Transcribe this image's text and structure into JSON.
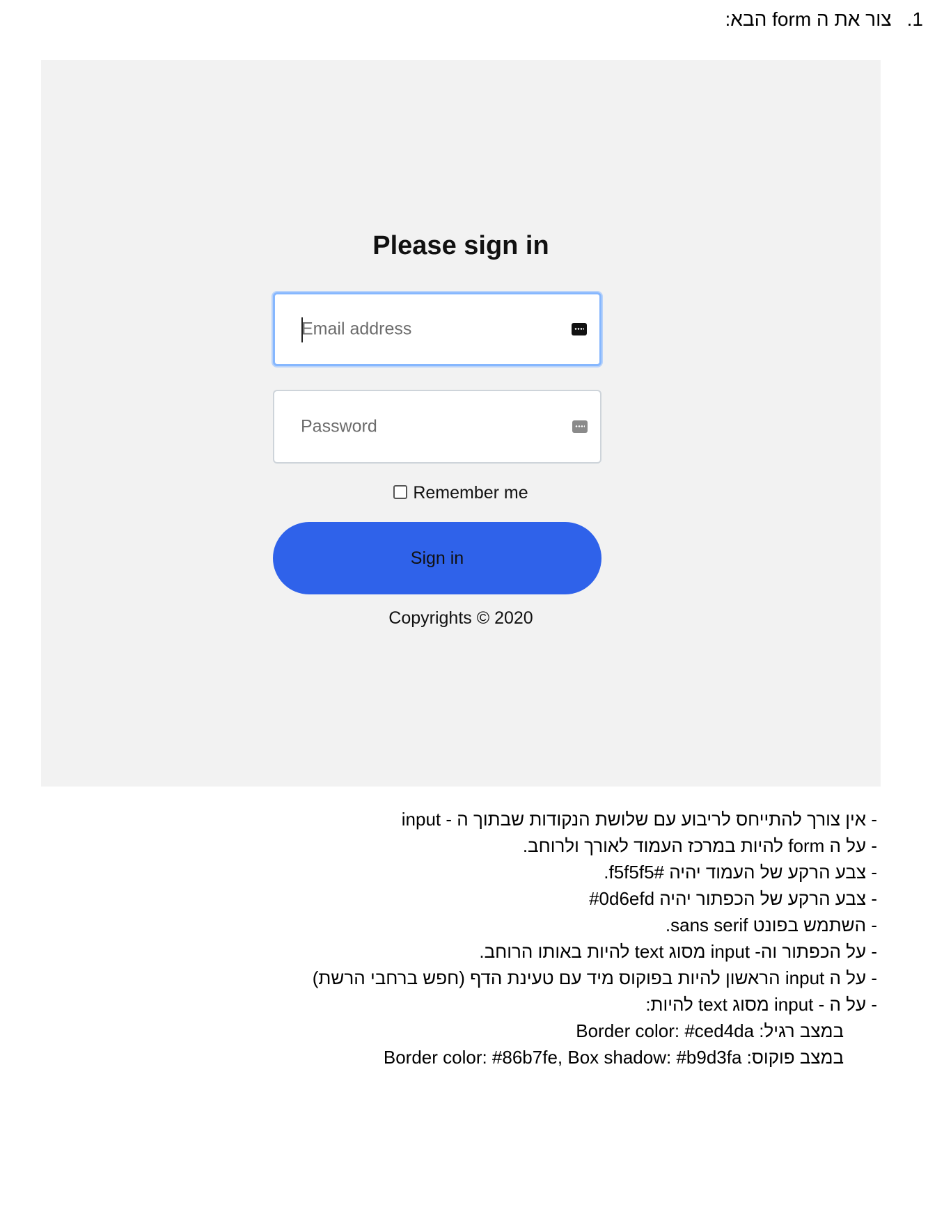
{
  "heading": {
    "number": "1.",
    "text": "צור את ה form הבא:"
  },
  "form": {
    "title": "Please sign in",
    "email_placeholder": "Email address",
    "password_placeholder": "Password",
    "remember_label": "Remember me",
    "signin_label": "Sign in",
    "copyright": "Copyrights © 2020",
    "colors": {
      "page_bg": "#f2f2f2",
      "button_bg": "#2f62ea",
      "focus_border": "#86b7fe",
      "focus_shadow": "#b9d3fa",
      "border": "#ced4da"
    },
    "icons": [
      "password-key-icon",
      "password-key-icon"
    ]
  },
  "notes": [
    "- אין צורך להתייחס לריבוע עם שלושת הנקודות שבתוך ה - input",
    "- על ה form   להיות במרכז העמוד לאורך ולרוחב.",
    "- צבע הרקע של העמוד יהיה  #f5f5f5.",
    "- צבע הרקע של הכפתור יהיה #0d6efd",
    "- השתמש בפונט sans serif.",
    "- על הכפתור וה- input מסוג text להיות באותו הרוחב.",
    "- על ה input  הראשון להיות בפוקוס מיד עם טעינת הדף (חפש ברחבי הרשת)",
    "- על ה - input  מסוג text להיות:",
    "במצב רגיל: Border color: #ced4da",
    "במצב פוקוס: Border color: #86b7fe, Box shadow: #b9d3fa"
  ]
}
